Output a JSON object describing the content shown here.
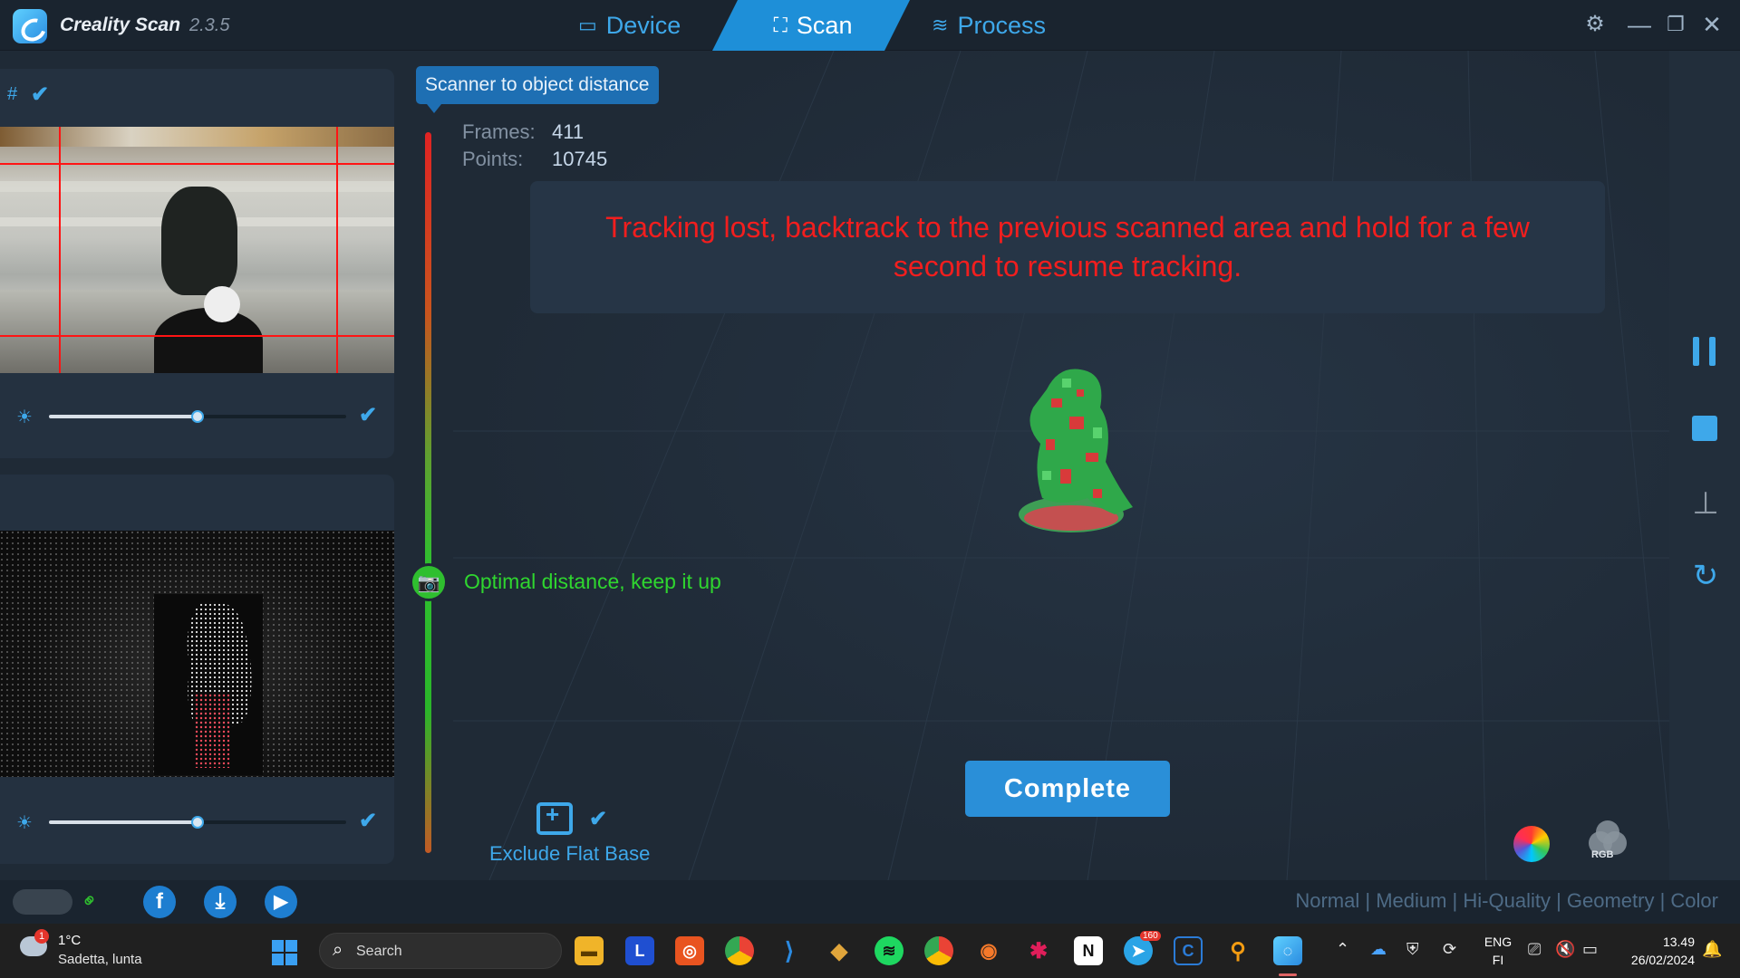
{
  "app": {
    "name": "Creality Scan",
    "version": "2.3.5"
  },
  "tabs": [
    {
      "label": "Device",
      "icon": "device-icon"
    },
    {
      "label": "Scan",
      "icon": "scan-icon",
      "active": true
    },
    {
      "label": "Process",
      "icon": "layers-icon"
    }
  ],
  "window_controls": {
    "settings": "⚙",
    "minimize": "—",
    "restore": "❐",
    "close": "✕"
  },
  "camera_panel": {
    "hash": "#",
    "rgb_exposure": 0.5,
    "depth_exposure": 0.5
  },
  "scan": {
    "tooltip": "Scanner to object distance",
    "frames_label": "Frames:",
    "frames_value": "411",
    "points_label": "Points:",
    "points_value": "10745",
    "warning": "Tracking lost, backtrack to the previous scanned area and hold for a few second to resume tracking.",
    "distance_status": "Optimal distance, keep it up",
    "exclude_flat_base": "Exclude Flat Base",
    "complete_label": "Complete",
    "rgb_label": "RGB"
  },
  "status_bar": {
    "quality_modes": "Normal | Medium | Hi-Quality | Geometry | Color"
  },
  "taskbar": {
    "weather_temp": "1°C",
    "weather_desc": "Sadetta, lunta",
    "weather_badge": "1",
    "search_label": "Search",
    "lang_top": "ENG",
    "lang_bottom": "FI",
    "time": "13.49",
    "date": "26/02/2024",
    "telegram_badge": "160",
    "apps": [
      "file-explorer",
      "l-app",
      "ubuntu",
      "chrome",
      "vscode",
      "git-app",
      "spotify",
      "chrome-dev",
      "blender",
      "slack",
      "notion",
      "telegram",
      "c-app",
      "search-app",
      "creality-scan"
    ]
  },
  "colors": {
    "accent": "#3ea8ea",
    "warning": "#f21e1e",
    "ok": "#2fd62f"
  }
}
